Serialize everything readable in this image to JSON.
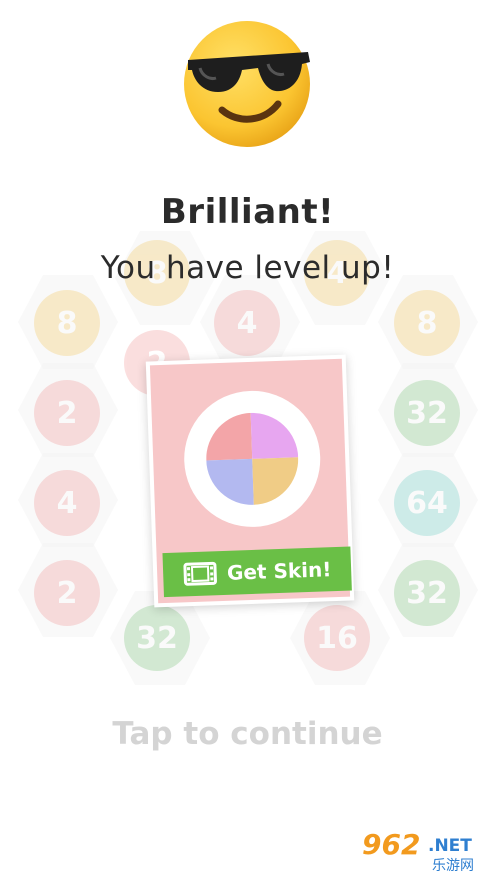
{
  "message": {
    "title": "Brilliant!",
    "subtitle": "You have level up!"
  },
  "reward_card": {
    "button_label": "Get Skin!",
    "video_icon": "film-icon",
    "colors": {
      "card": "#f7c7c8",
      "button": "#6abf46",
      "quadrants": [
        "#f3a5a8",
        "#e7a6f0",
        "#b3b9f0",
        "#f0cc86"
      ]
    }
  },
  "continue_label": "Tap to continue",
  "emoji_icon": "sunglasses-face-icon",
  "board_tiles": [
    "8",
    "8",
    "4",
    "8",
    "2",
    "32",
    "2",
    "4",
    "64",
    "2",
    "32",
    "32",
    "16",
    "4"
  ],
  "watermark": {
    "brand": "962",
    "suffix": ".NET",
    "text": "乐游网"
  }
}
